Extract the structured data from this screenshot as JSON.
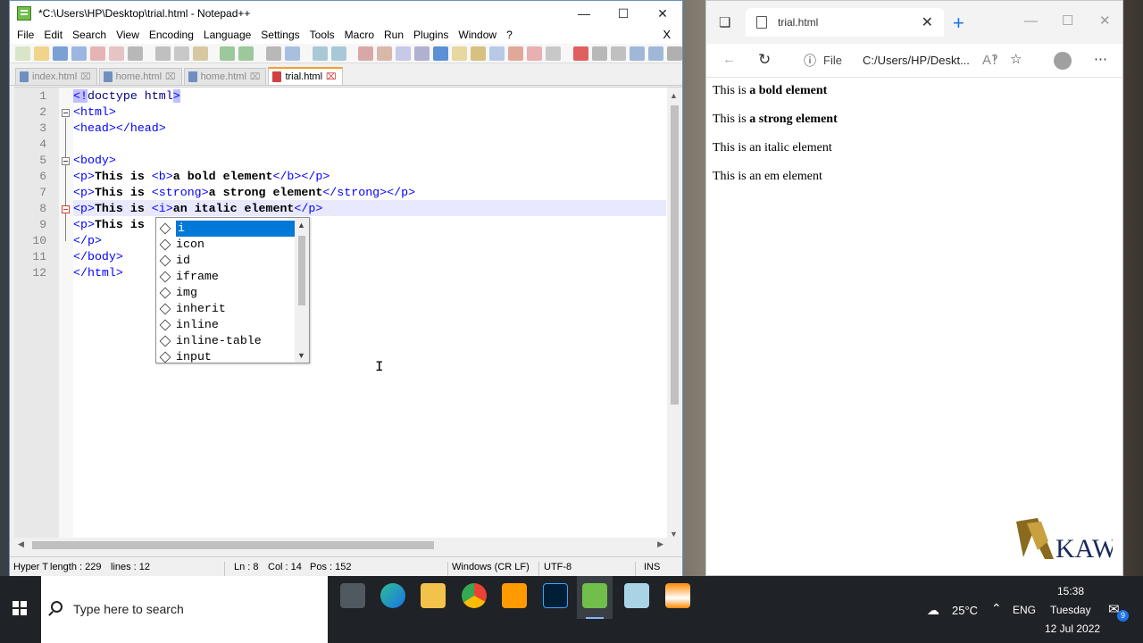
{
  "npp": {
    "title": "*C:\\Users\\HP\\Desktop\\trial.html - Notepad++",
    "menu": [
      "File",
      "Edit",
      "Search",
      "View",
      "Encoding",
      "Language",
      "Settings",
      "Tools",
      "Macro",
      "Run",
      "Plugins",
      "Window",
      "?"
    ],
    "menu_close": "X",
    "tabs": [
      {
        "label": "index.html",
        "active": false
      },
      {
        "label": "home.html",
        "active": false
      },
      {
        "label": "home.html",
        "active": false
      },
      {
        "label": "trial.html",
        "active": true
      }
    ],
    "line_numbers": [
      "1",
      "2",
      "3",
      "4",
      "5",
      "6",
      "7",
      "8",
      "9",
      "10",
      "11",
      "12"
    ],
    "autocomplete": [
      "i",
      "icon",
      "id",
      "iframe",
      "img",
      "inherit",
      "inline",
      "inline-table",
      "input"
    ],
    "status": {
      "type": "Hyper T",
      "length": "length : 229",
      "lines": "lines : 12",
      "ln": "Ln : 8",
      "col": "Col : 14",
      "pos": "Pos : 152",
      "eol": "Windows (CR LF)",
      "encoding": "UTF-8",
      "mode": "INS"
    }
  },
  "edge": {
    "tab_title": "trial.html",
    "address_label": "File",
    "address": "C:/Users/HP/Deskt...",
    "page": {
      "line1_prefix": "This is ",
      "line1_bold": "a bold element",
      "line2_prefix": "This is ",
      "line2_bold": "a strong element",
      "line3": "This is an italic element",
      "line4": "This is an em element"
    }
  },
  "watermark": "KAWA",
  "taskbar": {
    "search_placeholder": "Type here to search",
    "temperature": "25°C",
    "language": "ENG",
    "time": "15:38",
    "day": "Tuesday",
    "date": "12 Jul 2022",
    "notifications": "9"
  },
  "colors": {
    "edge_selection": "#0078d7",
    "current_line": "#e8e8ff",
    "tag": "#0000ff"
  }
}
